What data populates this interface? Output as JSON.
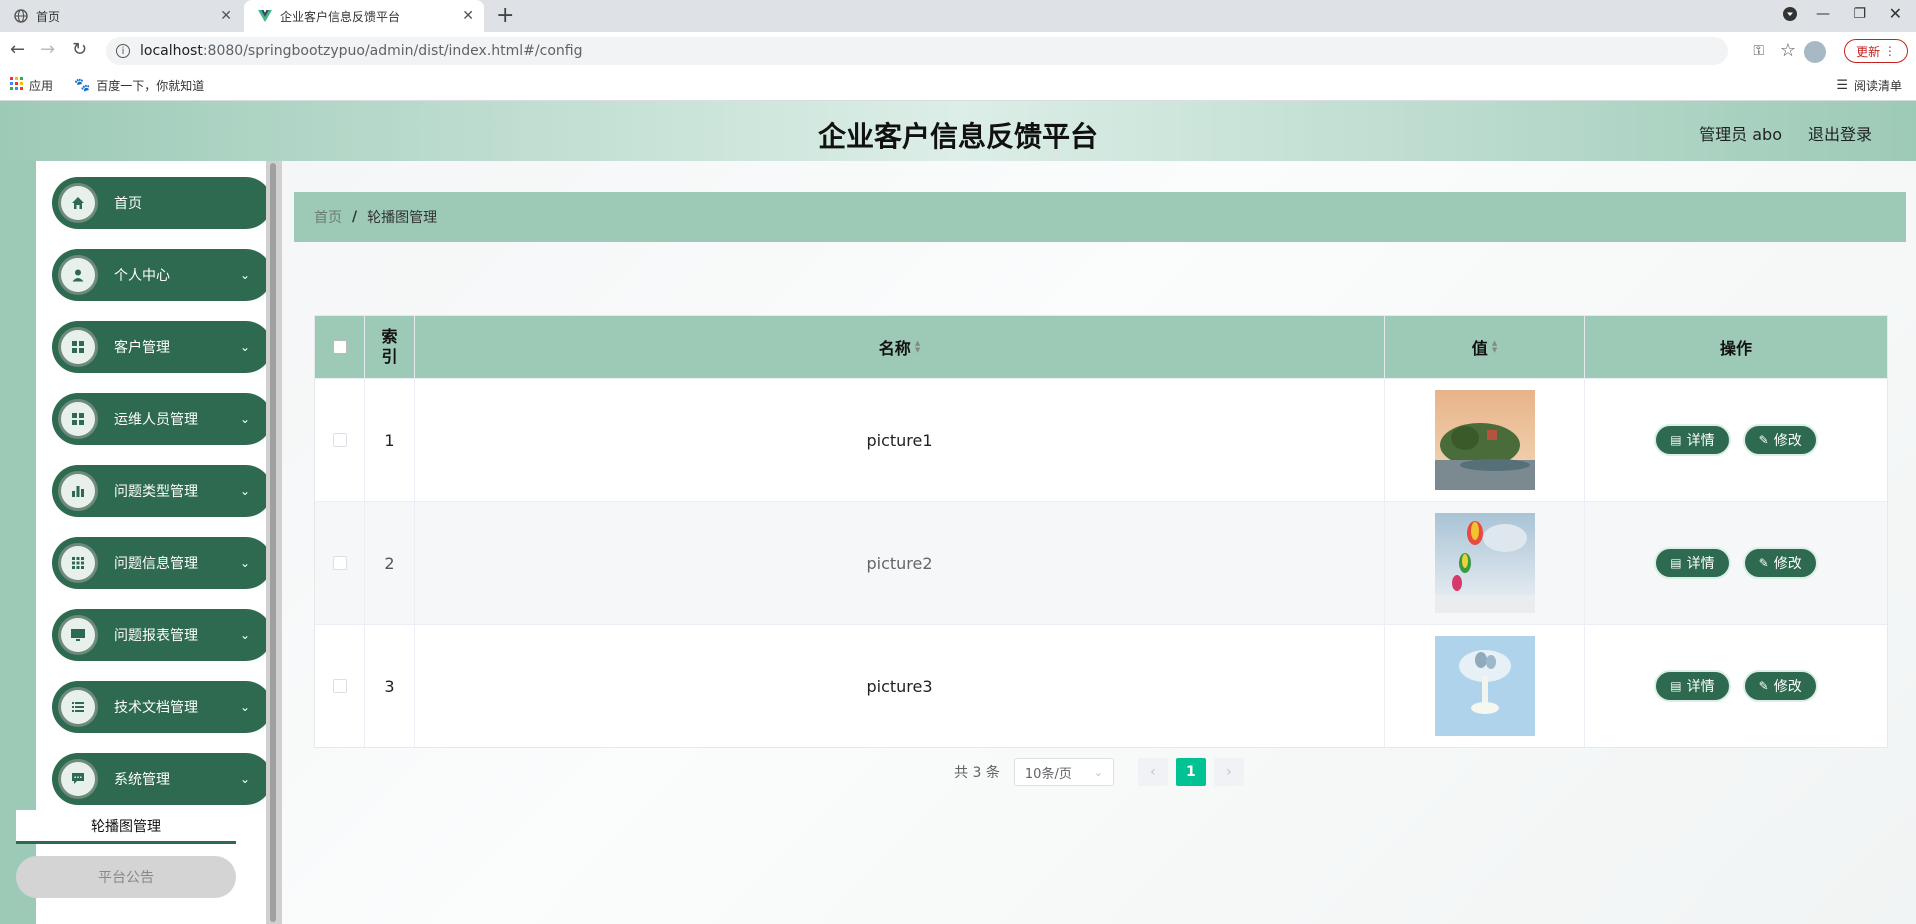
{
  "browser": {
    "tabs": [
      {
        "title": "首页",
        "active": false
      },
      {
        "title": "企业客户信息反馈平台",
        "active": true
      }
    ],
    "url_host": "localhost",
    "url_path": ":8080/springbootzypuo/admin/dist/index.html#/config",
    "update_label": "更新",
    "bookmarks": [
      {
        "label": "应用"
      },
      {
        "label": "百度一下，你就知道"
      }
    ],
    "reading_list_label": "阅读清单"
  },
  "header": {
    "title": "企业客户信息反馈平台",
    "admin_label": "管理员 abo",
    "logout_label": "退出登录"
  },
  "sidebar": {
    "items": [
      {
        "label": "首页",
        "icon": "home-icon",
        "has_children": false
      },
      {
        "label": "个人中心",
        "icon": "user-icon",
        "has_children": true
      },
      {
        "label": "客户管理",
        "icon": "grid-icon",
        "has_children": true
      },
      {
        "label": "运维人员管理",
        "icon": "grid-icon",
        "has_children": true
      },
      {
        "label": "问题类型管理",
        "icon": "bar-chart-icon",
        "has_children": true
      },
      {
        "label": "问题信息管理",
        "icon": "apps-icon",
        "has_children": true
      },
      {
        "label": "问题报表管理",
        "icon": "monitor-icon",
        "has_children": true
      },
      {
        "label": "技术文档管理",
        "icon": "list-icon",
        "has_children": true
      },
      {
        "label": "系统管理",
        "icon": "message-icon",
        "has_children": true
      }
    ],
    "submenu": {
      "active": "轮播图管理",
      "inactive": "平台公告"
    }
  },
  "breadcrumb": {
    "home": "首页",
    "separator": "/",
    "current": "轮播图管理"
  },
  "table": {
    "headers": {
      "index": "索引",
      "name": "名称",
      "value": "值",
      "actions": "操作"
    },
    "rows": [
      {
        "index": "1",
        "name": "picture1",
        "image": "landscape-thumbnail"
      },
      {
        "index": "2",
        "name": "picture2",
        "image": "balloons-thumbnail"
      },
      {
        "index": "3",
        "name": "picture3",
        "image": "tree-thumbnail"
      }
    ],
    "detail_label": "详情",
    "edit_label": "修改"
  },
  "pagination": {
    "total_text": "共 3 条",
    "page_size": "10条/页",
    "current_page": "1"
  },
  "colors": {
    "primary": "#2d6a4f",
    "header_bg": "#9dcab7",
    "page_active": "#00c292"
  }
}
